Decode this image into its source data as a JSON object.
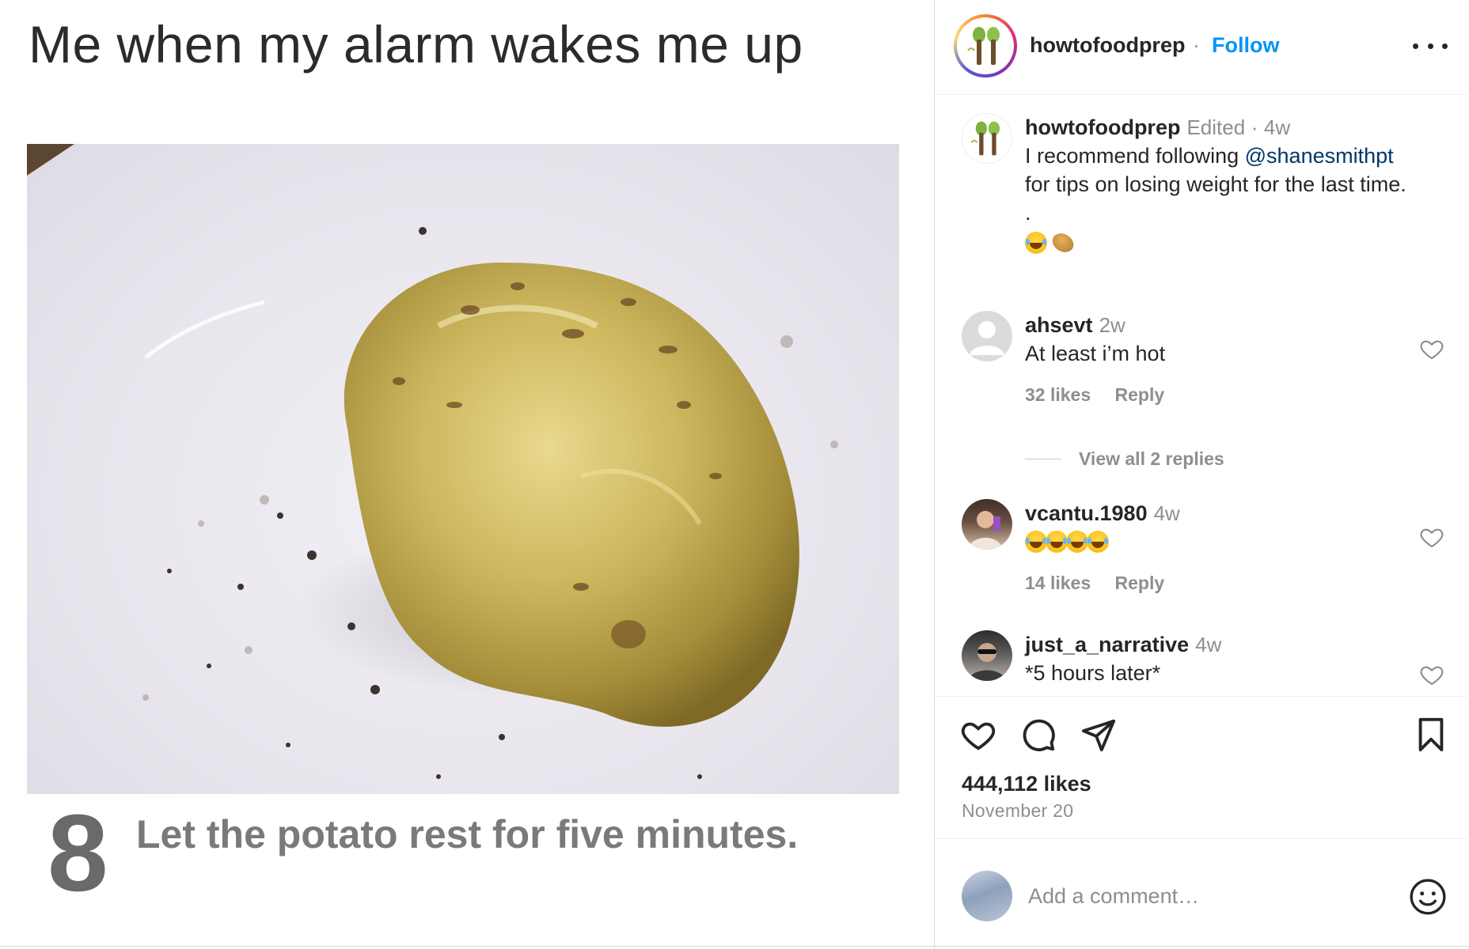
{
  "meme": {
    "top_caption": "Me when my alarm wakes me up",
    "step_number": "8",
    "step_text": "Let the potato rest for five minutes."
  },
  "header": {
    "username": "howtofoodprep",
    "separator": "·",
    "follow_label": "Follow",
    "more_icon": "more-horizontal-icon"
  },
  "caption": {
    "username": "howtofoodprep",
    "edited": "Edited",
    "dot": "·",
    "time": "4w",
    "text_before": "I recommend following ",
    "mention": "@shanesmithpt",
    "text_after": " for tips on losing weight for the last time.",
    "dot_line": ".",
    "emojis": [
      "laughing-tears-emoji",
      "potato-emoji"
    ]
  },
  "comments": [
    {
      "username": "ahsevt",
      "time": "2w",
      "text": "At least i’m hot",
      "likes": "32 likes",
      "reply_label": "Reply",
      "view_replies": "View all 2 replies"
    },
    {
      "username": "vcantu.1980",
      "time": "4w",
      "emoji_count": 4,
      "likes": "14 likes",
      "reply_label": "Reply"
    },
    {
      "username": "just_a_narrative",
      "time": "4w",
      "text": "*5 hours later*"
    }
  ],
  "actions": {
    "icons": [
      "heart-icon",
      "comment-icon",
      "share-icon",
      "bookmark-icon"
    ],
    "likes": "444,112 likes",
    "date": "November 20"
  },
  "add_comment": {
    "placeholder": "Add a comment…",
    "emoji_icon": "smiley-icon"
  },
  "colors": {
    "follow_blue": "#0095f6",
    "mention_blue": "#00376b",
    "meta_gray": "#8e8e8e",
    "border": "#dbdbdb"
  }
}
